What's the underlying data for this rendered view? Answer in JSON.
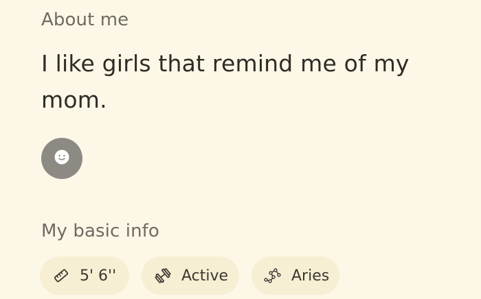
{
  "about": {
    "label": "About me",
    "text": "I like girls that remind me of my mom."
  },
  "basic_info": {
    "label": "My basic info",
    "chips": [
      {
        "label": "5' 6''",
        "icon": "ruler-icon"
      },
      {
        "label": "Active",
        "icon": "dumbbell-icon"
      },
      {
        "label": "Aries",
        "icon": "aries-constellation-icon"
      }
    ]
  },
  "colors": {
    "background": "#fcf7e6",
    "chip_background": "#f7efd3",
    "emoji_button": "#8d8a84",
    "text_primary": "#2f2b26",
    "text_secondary": "#6f6b63"
  },
  "emoji_button": {
    "icon": "smiley-face-icon"
  }
}
